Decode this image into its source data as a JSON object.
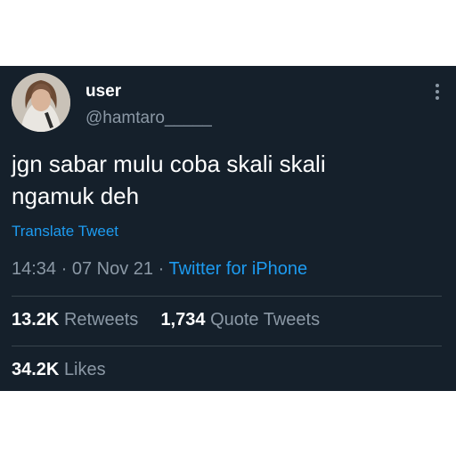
{
  "tweet": {
    "display_name": "user",
    "handle": "@hamtaro_____",
    "text_line1": "jgn sabar mulu coba skali skali",
    "text_line2": "ngamuk deh",
    "translate_label": "Translate Tweet",
    "time": "14:34",
    "date": "07 Nov 21",
    "separator": "·",
    "source": "Twitter for iPhone"
  },
  "stats": {
    "retweets_count": "13.2K",
    "retweets_label": "Retweets",
    "quotes_count": "1,734",
    "quotes_label": "Quote Tweets",
    "likes_count": "34.2K",
    "likes_label": "Likes"
  },
  "icons": {
    "more": "more-vertical-icon"
  },
  "colors": {
    "background": "#15202b",
    "accent": "#1d9bf0",
    "secondary_text": "#8b98a5",
    "divider": "#38444d"
  }
}
